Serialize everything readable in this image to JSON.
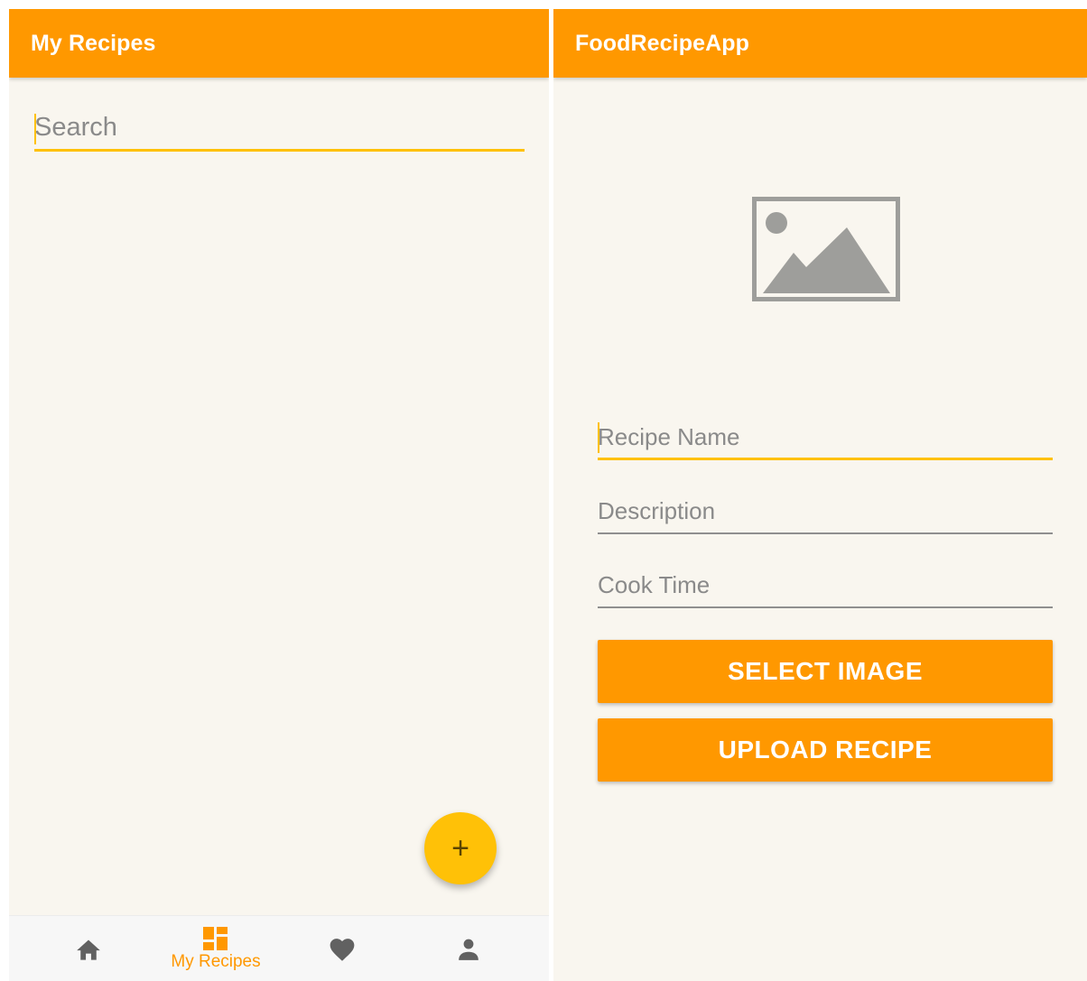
{
  "left_screen": {
    "app_bar": {
      "title": "My Recipes"
    },
    "search": {
      "placeholder": "Search"
    },
    "fab": {
      "icon": "plus-icon",
      "label": "+"
    },
    "bottom_nav": {
      "items": [
        {
          "icon": "home-icon",
          "label": "",
          "active": false
        },
        {
          "icon": "dashboard-icon",
          "label": "My Recipes",
          "active": true
        },
        {
          "icon": "heart-icon",
          "label": "",
          "active": false
        },
        {
          "icon": "person-icon",
          "label": "",
          "active": false
        }
      ]
    }
  },
  "right_screen": {
    "app_bar": {
      "title": "FoodRecipeApp"
    },
    "image_placeholder": {
      "icon": "image-icon"
    },
    "fields": {
      "recipe_name": {
        "placeholder": "Recipe Name"
      },
      "description": {
        "placeholder": "Description"
      },
      "cook_time": {
        "placeholder": "Cook Time"
      }
    },
    "buttons": {
      "select_image": "SELECT IMAGE",
      "upload_recipe": "UPLOAD RECIPE"
    }
  },
  "colors": {
    "primary": "#ff9800",
    "accent": "#ffc107",
    "background": "#f9f6ef",
    "icon_gray": "#616161",
    "placeholder_gray": "#9e9e9b"
  }
}
